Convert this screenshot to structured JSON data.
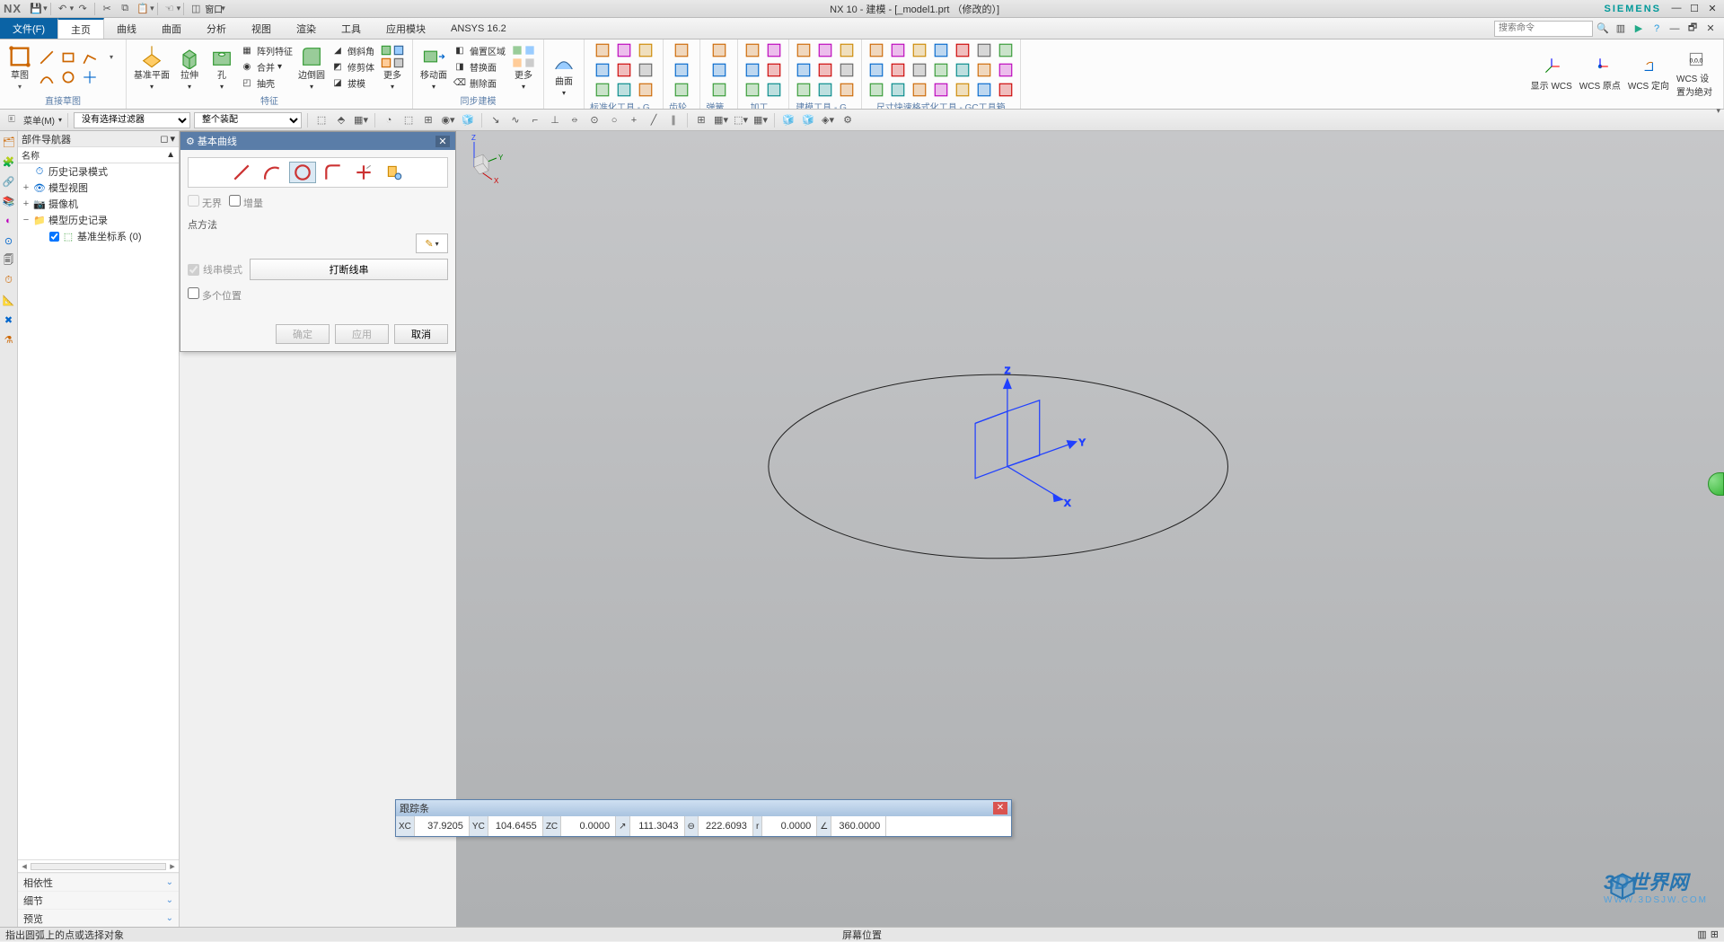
{
  "app": {
    "logo": "NX",
    "title": "NX 10 - 建模 - [_model1.prt （修改的）]",
    "brand": "SIEMENS",
    "window_dropdown": "窗口"
  },
  "menu": {
    "file": "文件(F)",
    "tabs": [
      "主页",
      "曲线",
      "曲面",
      "分析",
      "视图",
      "渲染",
      "工具",
      "应用模块",
      "ANSYS 16.2"
    ],
    "active": 0,
    "search_placeholder": "搜索命令"
  },
  "ribbon": {
    "groups": [
      {
        "label": "直接草图",
        "big": [
          {
            "name": "sketch",
            "label": "草图"
          }
        ],
        "grid": 6
      },
      {
        "label": "特征",
        "big": [
          {
            "name": "datum-plane",
            "label": "基准平面"
          },
          {
            "name": "extrude",
            "label": "拉伸"
          },
          {
            "name": "hole",
            "label": "孔"
          }
        ],
        "stack": [
          {
            "name": "pattern",
            "label": "阵列特征"
          },
          {
            "name": "unite",
            "label": "合并"
          },
          {
            "name": "draft",
            "label": "抽壳"
          }
        ]
      },
      {
        "label": "",
        "big": [
          {
            "name": "edge-blend",
            "label": "边倒圆"
          }
        ],
        "stack": [
          {
            "name": "chamfer",
            "label": "倒斜角"
          },
          {
            "name": "trim-body",
            "label": "修剪体"
          },
          {
            "name": "more",
            "label": "拔模"
          }
        ]
      },
      {
        "label": "",
        "big": [
          {
            "name": "more-menu",
            "label": "更多"
          }
        ]
      },
      {
        "label": "同步建模",
        "big": [
          {
            "name": "move-face",
            "label": "移动面"
          }
        ],
        "stack": [
          {
            "name": "offset-region",
            "label": "偏置区域"
          },
          {
            "name": "replace-face",
            "label": "替换面"
          },
          {
            "name": "delete-face",
            "label": "删除面"
          }
        ]
      },
      {
        "label": "",
        "big": [
          {
            "name": "more-sync",
            "label": "更多"
          }
        ]
      },
      {
        "label": "",
        "big": [
          {
            "name": "surface",
            "label": "曲面"
          }
        ]
      },
      {
        "label": "标准化工具 - G...",
        "grid": 9
      },
      {
        "label": "齿轮...",
        "grid": 3
      },
      {
        "label": "弹簧...",
        "grid": 3
      },
      {
        "label": "加工...",
        "grid": 6
      },
      {
        "label": "建模工具 - G...",
        "grid": 9
      },
      {
        "label": "尺寸快速格式化工具 - GC工具箱",
        "grid": 21
      },
      {
        "label": "",
        "wcs": [
          {
            "name": "show-wcs",
            "label": "显示 WCS"
          },
          {
            "name": "wcs-origin",
            "label": "WCS 原点"
          },
          {
            "name": "wcs-orient",
            "label": "WCS 定向"
          },
          {
            "name": "wcs-abs",
            "label": "WCS 设置为绝对"
          }
        ]
      }
    ]
  },
  "selbar": {
    "menu_btn": "菜单(M)",
    "filter": "没有选择过滤器",
    "assembly": "整个装配"
  },
  "nav": {
    "title": "部件导航器",
    "col": "名称",
    "rows": [
      {
        "indent": 0,
        "tw": "",
        "icon": "history-mode",
        "label": "历史记录模式",
        "ck": false
      },
      {
        "indent": 0,
        "tw": "+",
        "icon": "model-view",
        "label": "模型视图",
        "ck": false
      },
      {
        "indent": 0,
        "tw": "+",
        "icon": "camera",
        "label": "摄像机",
        "ck": false
      },
      {
        "indent": 0,
        "tw": "−",
        "icon": "folder",
        "label": "模型历史记录",
        "ck": false
      },
      {
        "indent": 1,
        "tw": "",
        "icon": "csys",
        "label": "基准坐标系 (0)",
        "ck": true
      }
    ],
    "sections": [
      "相依性",
      "细节",
      "预览"
    ]
  },
  "dialog": {
    "title": "基本曲线",
    "tools": [
      "line",
      "arc",
      "circle",
      "fillet",
      "trim",
      "edit"
    ],
    "tool_sel": 2,
    "chk_unbounded": "无界",
    "chk_increment": "增量",
    "lbl_point_method": "点方法",
    "chk_string_mode": "线串模式",
    "btn_break": "打断线串",
    "chk_multi": "多个位置",
    "ok": "确定",
    "apply": "应用",
    "cancel": "取消"
  },
  "tracking": {
    "title": "跟踪条",
    "cells": [
      {
        "tag": "XC",
        "val": "37.9205"
      },
      {
        "tag": "YC",
        "val": "104.6455"
      },
      {
        "tag": "ZC",
        "val": "0.0000"
      },
      {
        "tag": "↗",
        "val": "111.3043"
      },
      {
        "tag": "⊖",
        "val": "222.6093"
      },
      {
        "tag": "r",
        "val": "0.0000"
      },
      {
        "tag": "∠",
        "val": "360.0000"
      }
    ]
  },
  "status": {
    "left": "指出圆弧上的点或选择对象",
    "mid": "屏幕位置"
  },
  "watermark": {
    "t1": "3D世界网",
    "t2": "WWW.3DSJW.COM"
  },
  "axes": {
    "x": "X",
    "y": "Y",
    "z": "Z"
  }
}
